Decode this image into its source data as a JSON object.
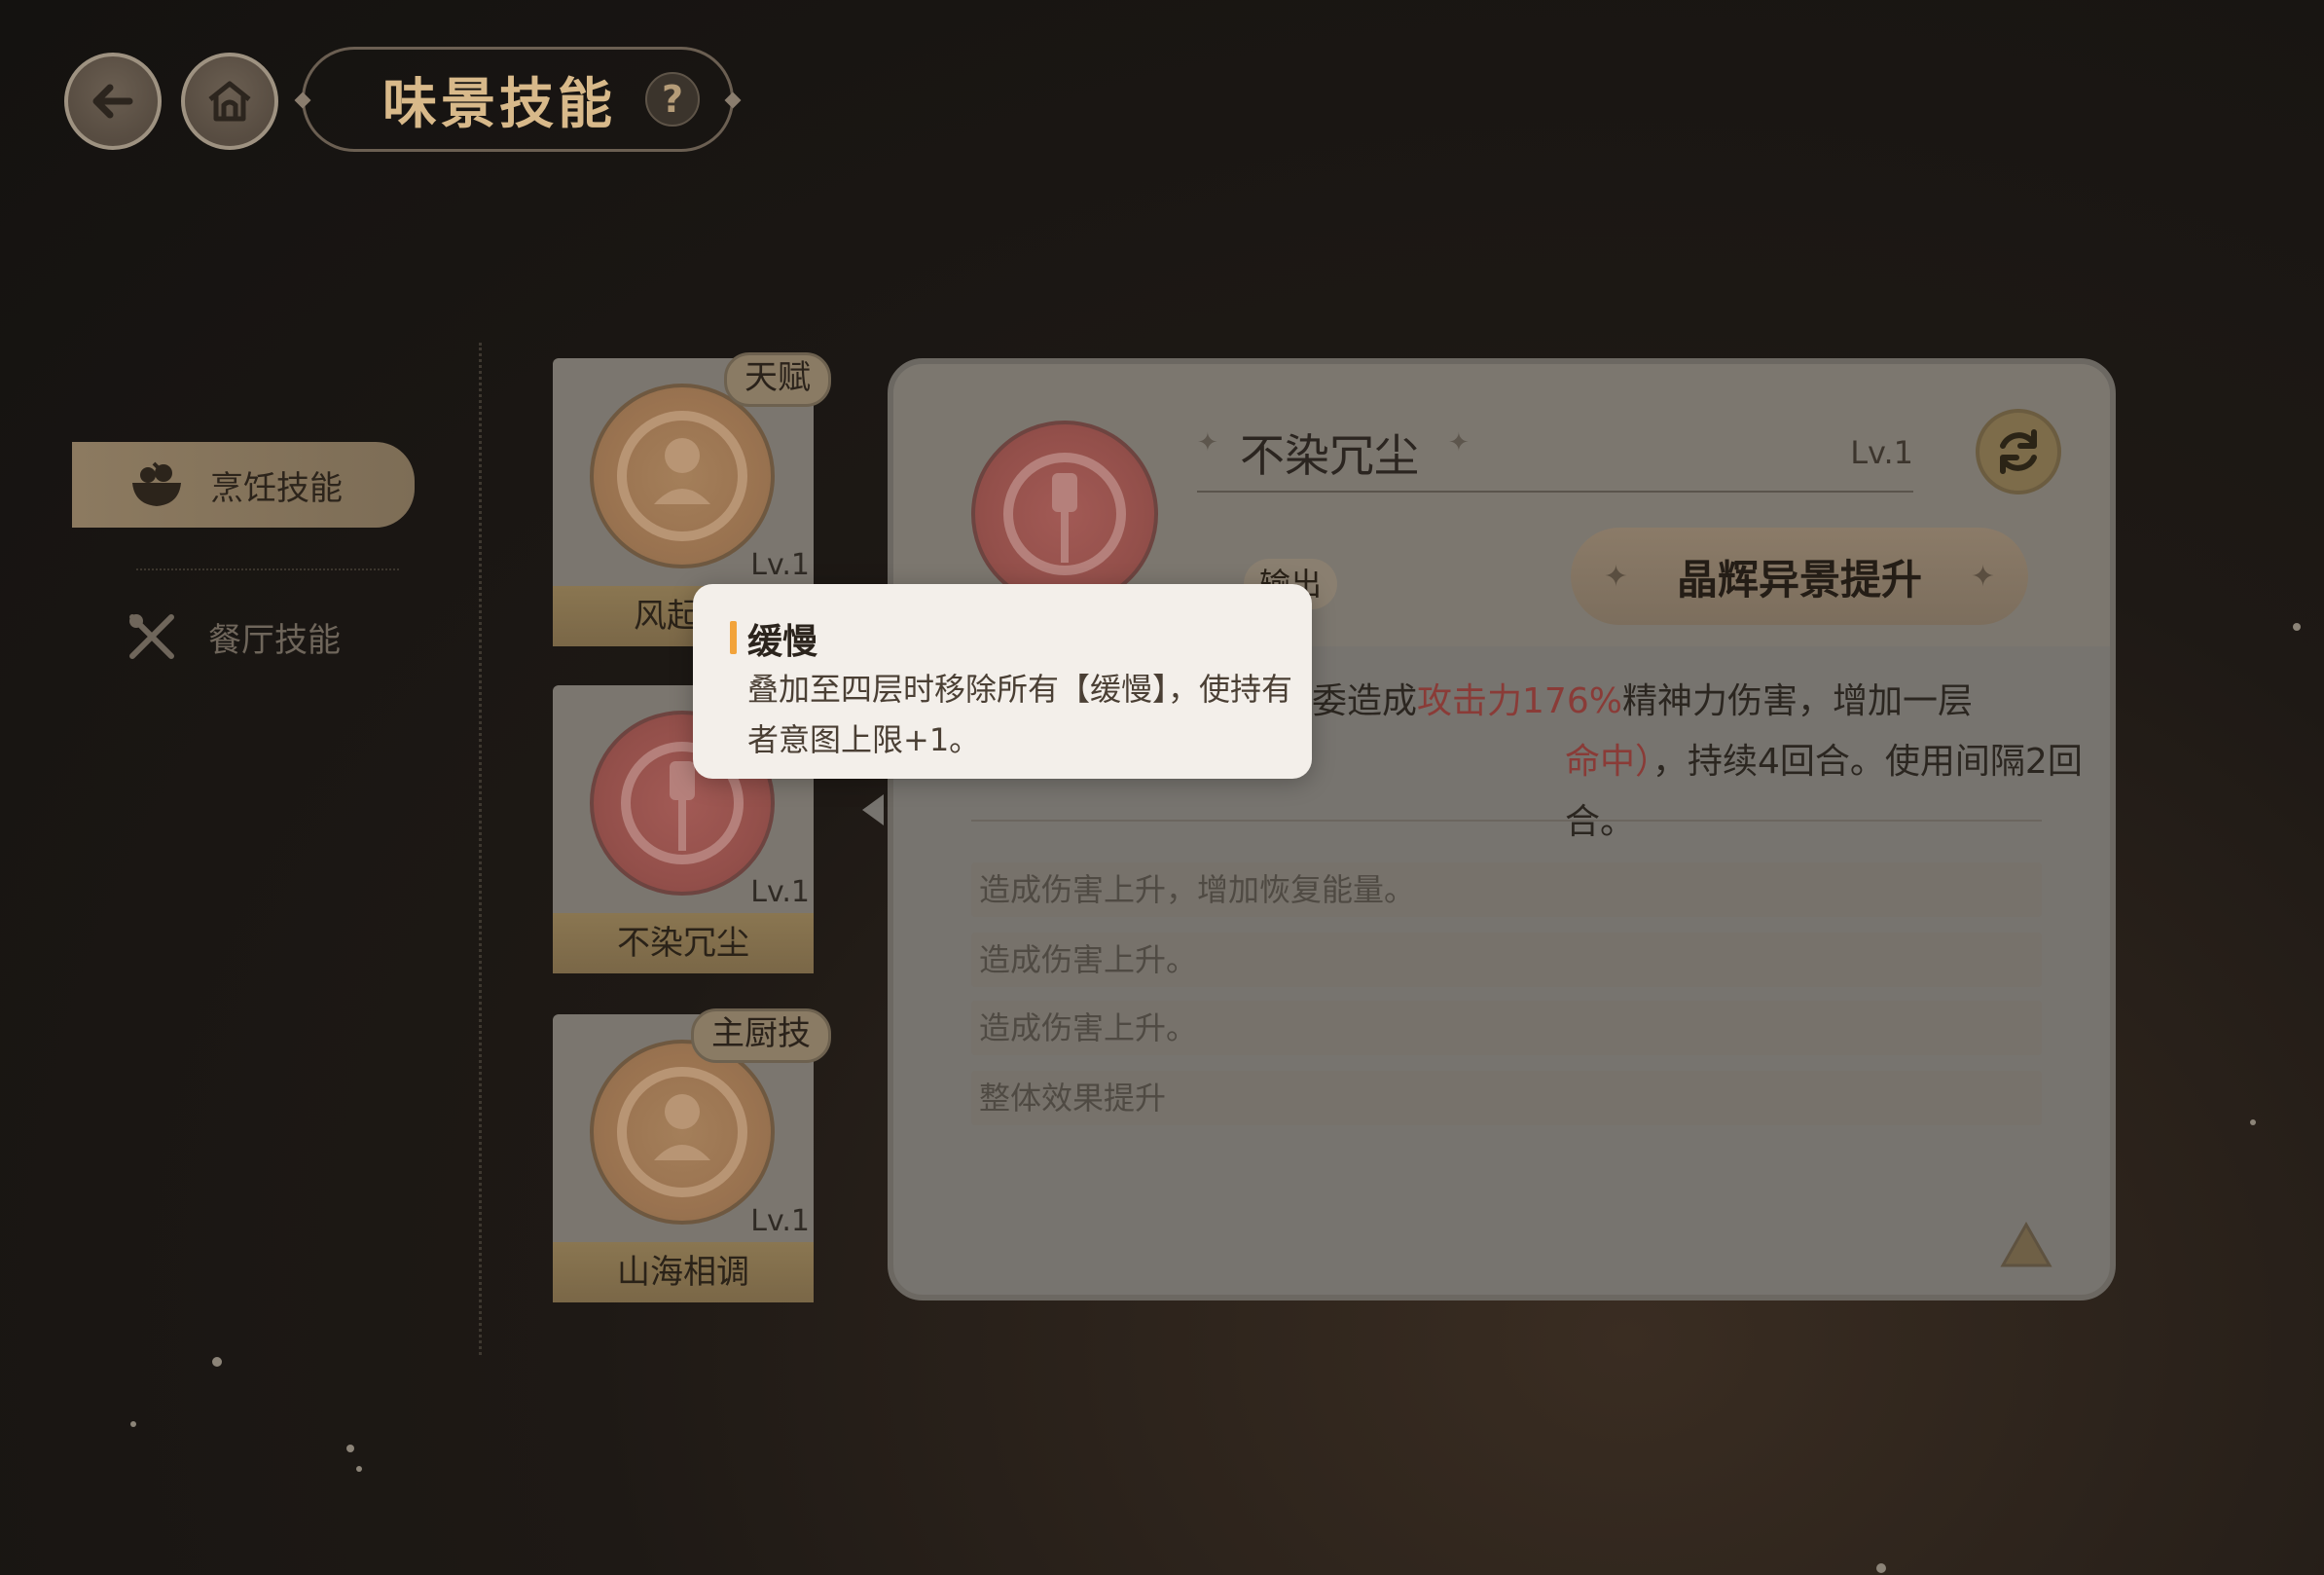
{
  "header": {
    "title": "味景技能",
    "help_label": "?"
  },
  "nav": {
    "items": [
      {
        "label": "烹饪技能",
        "active": true
      },
      {
        "label": "餐厅技能",
        "active": false
      }
    ]
  },
  "skills": [
    {
      "name": "风起青",
      "level": "Lv.1",
      "badge": "天赋",
      "color": "orange"
    },
    {
      "name": "不染冗尘",
      "level": "Lv.1",
      "badge": "",
      "color": "red"
    },
    {
      "name": "山海相调",
      "level": "Lv.1",
      "badge": "主厨技",
      "color": "orange"
    }
  ],
  "detail": {
    "skill_name": "不染冗尘",
    "level": "Lv.1",
    "tag": "输出",
    "upgrade_label": "晶辉异景提升",
    "desc_line1_prefix": "委造成",
    "desc_line1_highlight": "攻击力176%",
    "desc_line1_suffix": "精神力伤害，增加一层",
    "desc_line2_highlight": "命中）",
    "desc_line2_suffix": "，持续4回合。使用间隔2回合。",
    "effects": [
      "造成伤害上升，增加恢复能量。",
      "造成伤害上升。",
      "造成伤害上升。",
      "整体效果提升"
    ]
  },
  "tooltip": {
    "title": "缓慢",
    "body": "叠加至四层时移除所有【缓慢】，使持有者意图上限+1。"
  },
  "colors": {
    "accent_gold": "#d8b98a",
    "highlight_red": "#8a3b37",
    "tooltip_bar": "#f2a33a"
  }
}
